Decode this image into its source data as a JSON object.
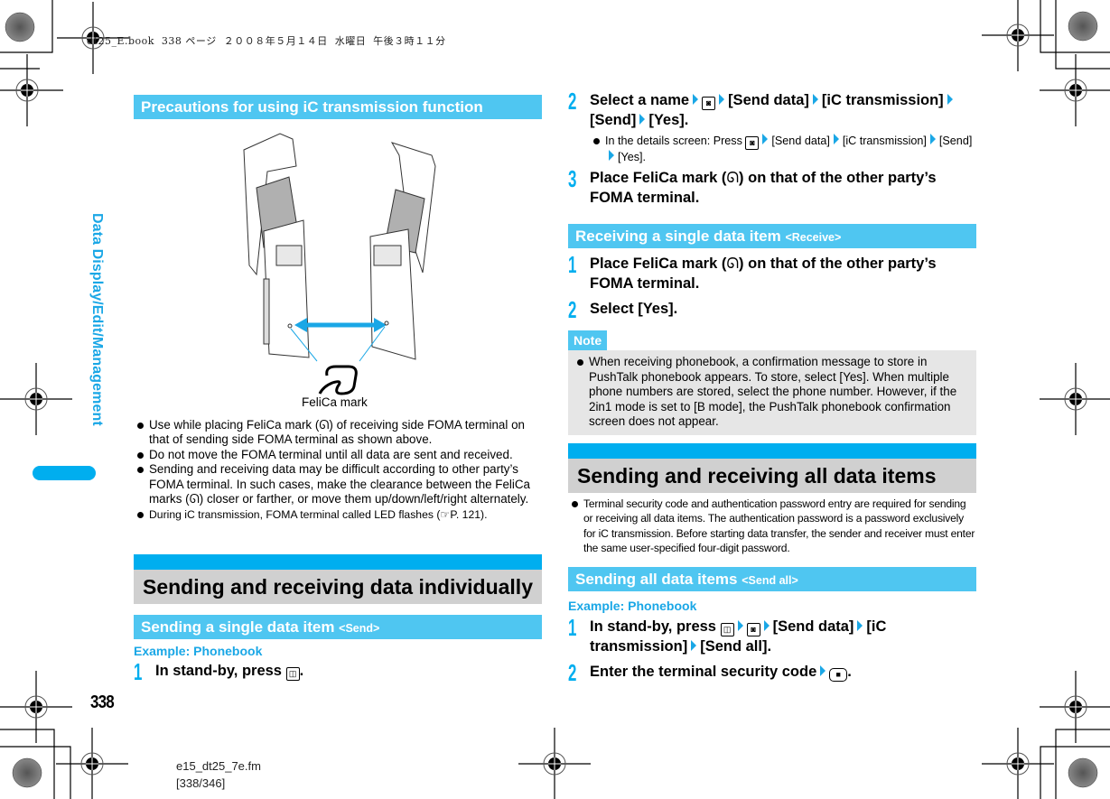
{
  "slug": {
    "text": "dt25_E.book  338 ページ  ２００８年５月１４日  水曜日  午後３時１１分"
  },
  "side_tab": {
    "label": "Data Display/Edit/Management",
    "color": "#1aa7e6"
  },
  "page_number": "338",
  "footer": {
    "file": "e15_dt25_7e.fm",
    "pages": "[338/346]"
  },
  "colors": {
    "accent": "#00aeef",
    "bar": "#4fc6f1",
    "gray_bar": "#d0d0d0",
    "note_bg": "#e6e6e6"
  },
  "icons": {
    "arrow": "triangle-right-icon",
    "phonebook_key": "phonebook-key-icon",
    "camera_key": "camera-key-icon",
    "enter_key": "enter-key-icon",
    "felica_mark": "felica-mark-icon",
    "reference": "reference-hand-icon"
  },
  "left": {
    "precautions": {
      "title": "Precautions for using iC transmission function",
      "figure_caption": "FeliCa mark",
      "bullets": [
        [
          "Use while placing FeliCa mark (",
          ") of receiving side FOMA terminal on that of sending side FOMA terminal as shown above."
        ],
        [
          "Do not move the FOMA terminal until all data are sent and received."
        ],
        [
          "Sending and receiving data may be difficult according to other party’s FOMA terminal. In such cases, make the clearance between the FeliCa marks (",
          ") closer or farther, or move them up/down/left/right alternately."
        ],
        [
          "During iC transmission, FOMA terminal called LED flashes (",
          "P. 121)."
        ]
      ]
    },
    "section_individual": {
      "title": "Sending and receiving data individually"
    },
    "send_single": {
      "title": "Sending a single data item",
      "tag": "<Send>",
      "example": "Example: Phonebook",
      "step1": {
        "num": "1",
        "text": "In stand-by, press",
        "end": "."
      }
    }
  },
  "right": {
    "send_single_cont": {
      "step2": {
        "num": "2",
        "parts": [
          "Select a name",
          "[Send data]",
          "[iC transmission]",
          "[Send]",
          "[Yes]."
        ],
        "bullet": [
          "In the details screen: Press",
          "[Send data]",
          "[iC transmission]",
          "[Send]",
          "[Yes]."
        ]
      },
      "step3": {
        "num": "3",
        "pre": "Place FeliCa mark (",
        "post": ") on that of the other party’s FOMA terminal."
      }
    },
    "receive_single": {
      "title": "Receiving a single data item",
      "tag": "<Receive>",
      "step1": {
        "num": "1",
        "pre": "Place FeliCa mark (",
        "post": ") on that of the other party’s FOMA terminal."
      },
      "step2": {
        "num": "2",
        "text": "Select [Yes]."
      }
    },
    "note": {
      "label": "Note",
      "text": "When receiving phonebook, a confirmation message to store in PushTalk phonebook appears. To store, select [Yes]. When multiple phone numbers are stored, select the phone number. However, if the 2in1 mode is set to [B mode], the PushTalk phonebook confirmation screen does not appear."
    },
    "section_all": {
      "title": "Sending and receiving all data items",
      "bullet": "Terminal security code and authentication password entry are required for sending or receiving all data items. The authentication password is a password exclusively for iC transmission. Before starting data transfer, the sender and receiver must enter the same user-specified four-digit password."
    },
    "send_all": {
      "title": "Sending all data items",
      "tag": "<Send all>",
      "example": "Example: Phonebook",
      "step1": {
        "num": "1",
        "parts": [
          "In stand-by, press",
          "[Send data]",
          "[iC transmission]",
          "[Send all]."
        ]
      },
      "step2": {
        "num": "2",
        "text": "Enter the terminal security code",
        "end": "."
      }
    }
  }
}
